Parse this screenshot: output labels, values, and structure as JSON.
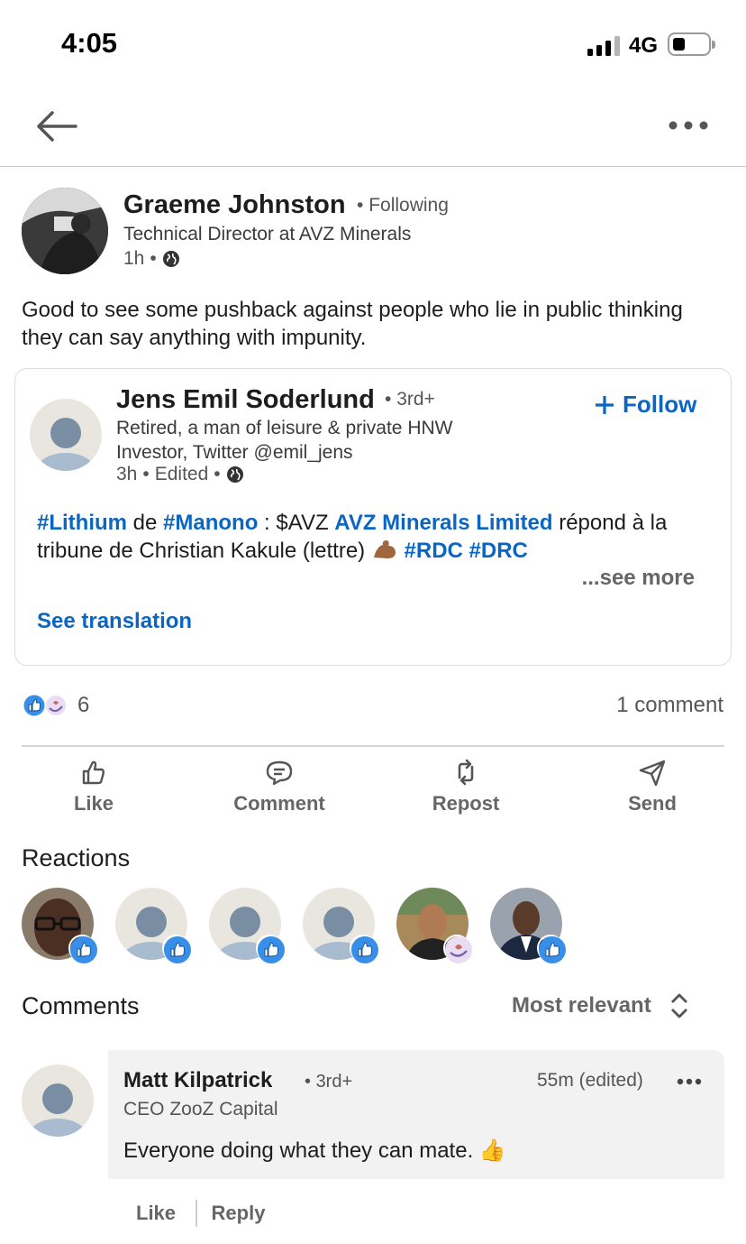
{
  "status_bar": {
    "time": "4:05",
    "network": "4G",
    "battery_level": 0.3
  },
  "nav": {
    "back_icon": "back-arrow-icon",
    "more_icon": "more-horizontal-icon"
  },
  "post": {
    "author": {
      "name": "Graeme Johnston",
      "following_label": "Following",
      "headline": "Technical Director at AVZ Minerals",
      "time": "1h"
    },
    "text": "Good to see some pushback against people who lie in public thinking they can say anything with impunity.",
    "shared": {
      "name": "Jens Emil Soderlund",
      "degree": "3rd+",
      "follow_label": "Follow",
      "headline": "Retired, a man of leisure & private HNW Investor, Twitter @emil_jens",
      "time": "3h",
      "edited": "Edited",
      "body": {
        "tag1": "#Lithium",
        "t1": " de ",
        "tag2": "#Manono",
        "t2": " : $AVZ ",
        "company": "AVZ Minerals Limited",
        "t3": "  répond à la tribune de Christian Kakule (lettre) ",
        "tag3": "#RDC",
        "t4": " ",
        "tag4": "#DRC"
      },
      "see_more": "...see more",
      "see_translation": "See translation"
    },
    "reaction_count": "6",
    "comment_count": "1 comment"
  },
  "actions": [
    {
      "label": "Like",
      "icon": "thumbs-up-icon"
    },
    {
      "label": "Comment",
      "icon": "comment-icon"
    },
    {
      "label": "Repost",
      "icon": "repost-icon"
    },
    {
      "label": "Send",
      "icon": "send-icon"
    }
  ],
  "reactions": {
    "title": "Reactions",
    "items": [
      {
        "avatar": "photo",
        "reaction": "like"
      },
      {
        "avatar": "placeholder",
        "reaction": "like"
      },
      {
        "avatar": "placeholder",
        "reaction": "like"
      },
      {
        "avatar": "placeholder",
        "reaction": "like"
      },
      {
        "avatar": "photo",
        "reaction": "support"
      },
      {
        "avatar": "photo",
        "reaction": "like"
      }
    ]
  },
  "comments": {
    "title": "Comments",
    "sort_label": "Most relevant",
    "items": [
      {
        "name": "Matt Kilpatrick",
        "degree": "3rd+",
        "time": "55m (edited)",
        "headline": "CEO ZooZ Capital",
        "text": "Everyone doing what they can mate. 👍",
        "like_label": "Like",
        "reply_label": "Reply"
      }
    ]
  },
  "colors": {
    "accent": "#0a66c2",
    "muted": "#666666",
    "bubble": "#f2f2f2"
  }
}
